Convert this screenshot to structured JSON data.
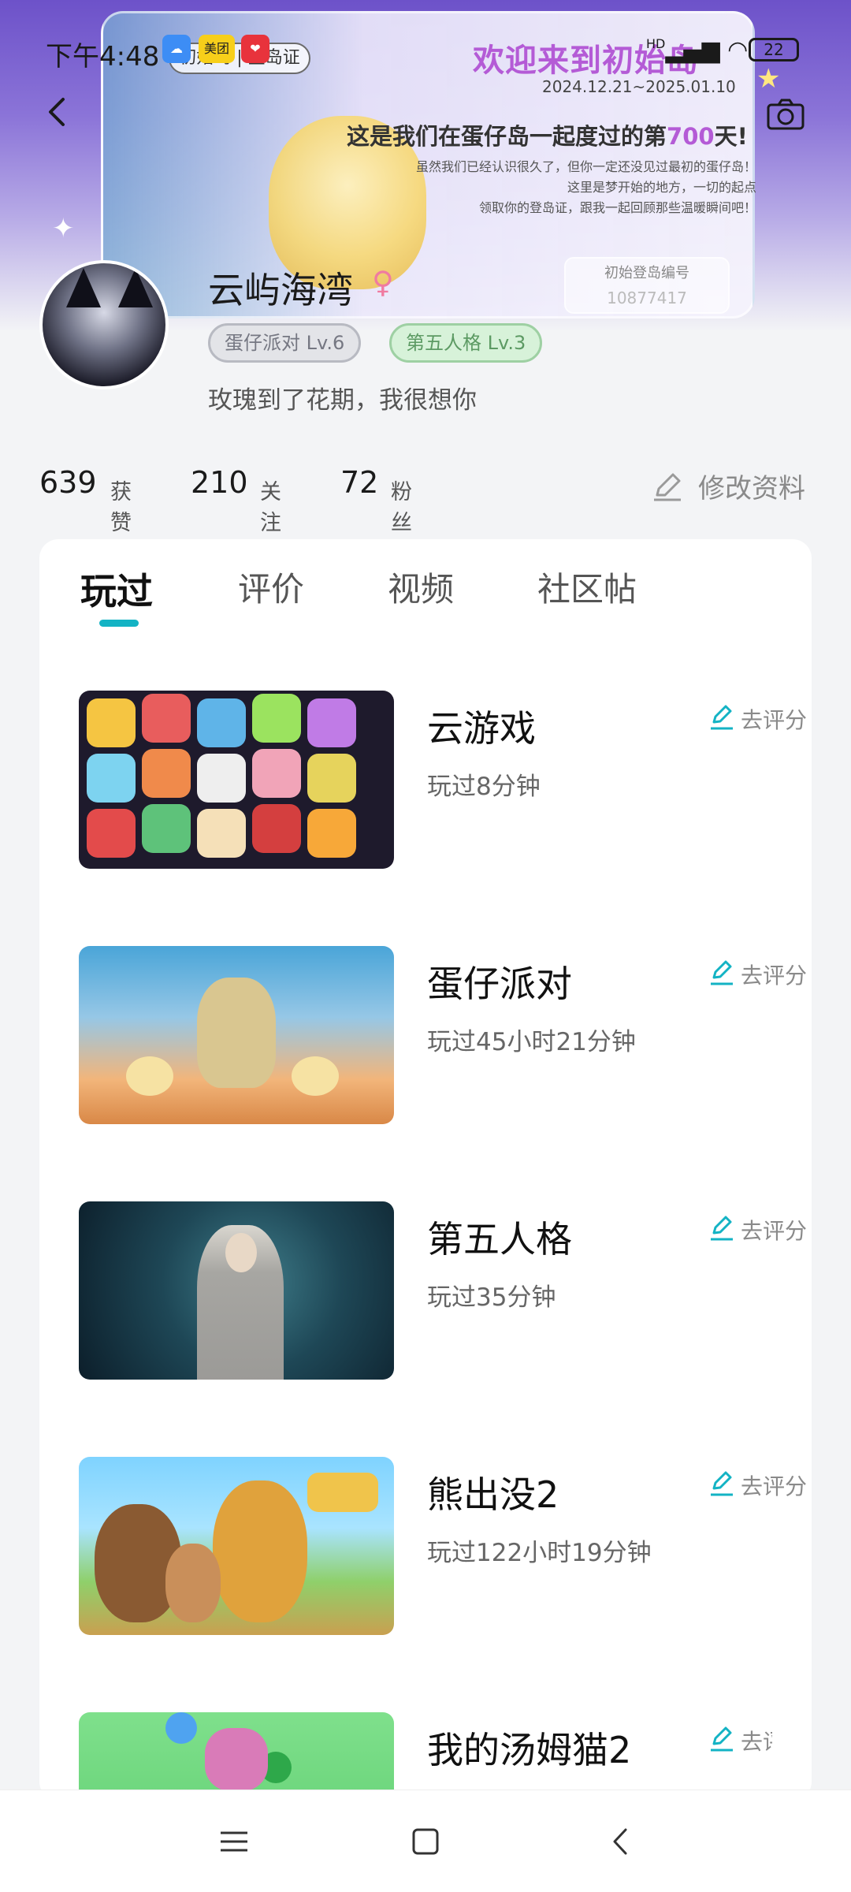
{
  "status_bar": {
    "time": "下午4:48",
    "app_badge_2": "美团",
    "network": "HD",
    "battery": "22"
  },
  "banner": {
    "chip_label": "初始岛 | 登岛证",
    "title": "欢迎来到初始岛",
    "date_range": "2024.12.21~2025.01.10",
    "days_prefix": "这是我们在蛋仔岛一起度过的第",
    "days_value": "700",
    "days_suffix": "天!",
    "note_1": "虽然我们已经认识很久了，但你一定还没见过最初的蛋仔岛！",
    "note_2": "这里是梦开始的地方，一切的起点",
    "note_3": "领取你的登岛证，跟我一起回顾那些温暖瞬间吧！",
    "id_label": "初始登岛编号",
    "id_value": "10877417"
  },
  "profile": {
    "username": "云屿海湾",
    "tags": [
      "蛋仔派对  Lv.6",
      "第五人格  Lv.3"
    ],
    "bio": "玫瑰到了花期，我很想你"
  },
  "stats": [
    {
      "value": "639",
      "label": "获赞"
    },
    {
      "value": "210",
      "label": "关注"
    },
    {
      "value": "72",
      "label": "粉丝"
    }
  ],
  "edit_profile_label": "修改资料",
  "tabs": [
    "玩过",
    "评价",
    "视频",
    "社区帖"
  ],
  "active_tab": "玩过",
  "rate_label": "去评分",
  "games": [
    {
      "name": "云游戏",
      "playtime": "玩过8分钟"
    },
    {
      "name": "蛋仔派对",
      "playtime": "玩过45小时21分钟"
    },
    {
      "name": "第五人格",
      "playtime": "玩过35分钟"
    },
    {
      "name": "熊出没2",
      "playtime": "玩过122小时19分钟"
    },
    {
      "name": "我的汤姆猫2",
      "playtime": ""
    }
  ],
  "colors": {
    "accent": "#13b3c4",
    "banner_purple": "#b45bd6",
    "tag_green": "#5c9a63"
  }
}
